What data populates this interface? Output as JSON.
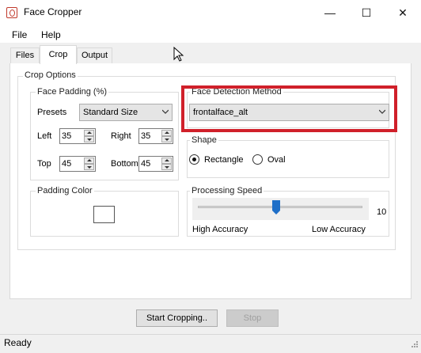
{
  "window": {
    "title": "Face Cropper"
  },
  "menu": {
    "file": "File",
    "help": "Help"
  },
  "tabs": [
    {
      "label": "Files",
      "active": false
    },
    {
      "label": "Crop",
      "active": true
    },
    {
      "label": "Output",
      "active": false
    }
  ],
  "crop_options": {
    "group_label": "Crop Options",
    "face_padding": {
      "label": "Face Padding (%)",
      "presets_label": "Presets",
      "presets_value": "Standard Size",
      "left_label": "Left",
      "left_value": "35",
      "right_label": "Right",
      "right_value": "35",
      "top_label": "Top",
      "top_value": "45",
      "bottom_label": "Bottom",
      "bottom_value": "45"
    },
    "face_detection": {
      "label": "Face Detection Method",
      "value": "frontalface_alt"
    },
    "shape": {
      "label": "Shape",
      "options": [
        "Rectangle",
        "Oval"
      ],
      "selected": "Rectangle"
    },
    "padding_color": {
      "label": "Padding Color",
      "color": "#ffffff"
    },
    "processing_speed": {
      "label": "Processing Speed",
      "value": "10",
      "slider_fraction": 0.5,
      "low_label": "High Accuracy",
      "high_label": "Low Accuracy"
    }
  },
  "buttons": {
    "start": "Start Cropping..",
    "stop": "Stop"
  },
  "status": {
    "text": "Ready"
  },
  "colors": {
    "highlight": "#d0202a",
    "slider_thumb": "#1e6fc8",
    "tab_active": "#ffffff"
  }
}
